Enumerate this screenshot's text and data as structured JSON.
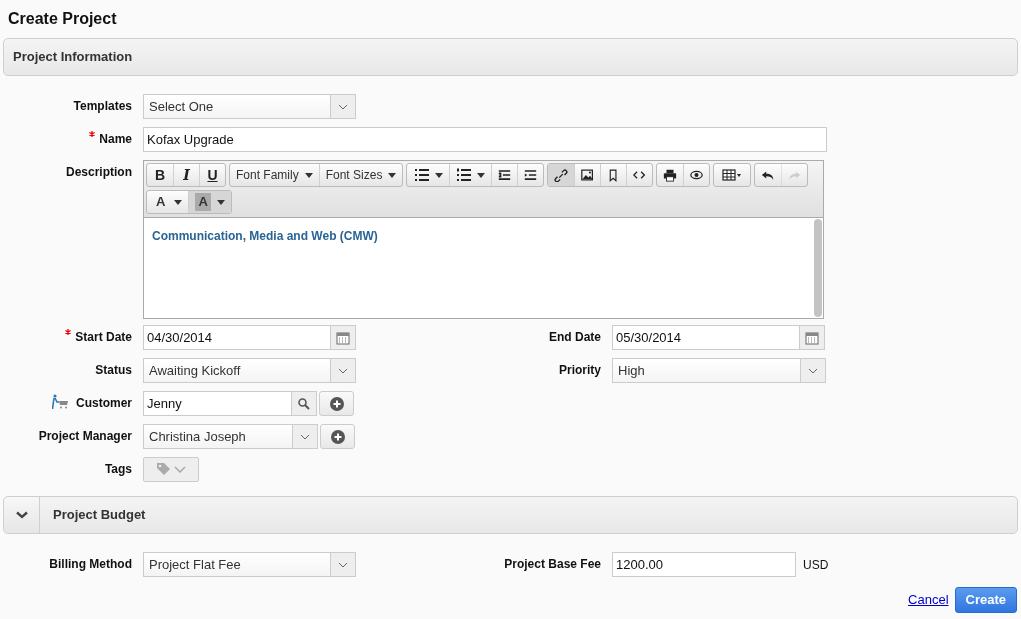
{
  "page_title": "Create Project",
  "info_section": {
    "title": "Project Information"
  },
  "templates": {
    "label": "Templates",
    "value": "Select One"
  },
  "name": {
    "label": "Name",
    "required": true,
    "value": "Kofax Upgrade"
  },
  "description": {
    "label": "Description",
    "toolbar": [
      [
        {
          "kind": "text",
          "label": "B",
          "selected": false,
          "disabled": false
        },
        {
          "kind": "text",
          "label": "I",
          "selected": false,
          "disabled": false
        },
        {
          "kind": "text",
          "label": "U",
          "selected": false,
          "disabled": false
        }
      ],
      [
        {
          "kind": "dropdown",
          "label": "Font Family",
          "selected": false,
          "disabled": false
        },
        {
          "kind": "dropdown",
          "label": "Font Sizes",
          "selected": false,
          "disabled": false
        }
      ],
      [
        {
          "kind": "bullets",
          "selected": false,
          "disabled": false
        },
        {
          "kind": "numbers",
          "selected": false,
          "disabled": false
        },
        {
          "kind": "outdent",
          "selected": false,
          "disabled": false
        },
        {
          "kind": "indent",
          "selected": false,
          "disabled": false
        }
      ],
      [
        {
          "kind": "link",
          "selected": true,
          "disabled": false
        },
        {
          "kind": "image",
          "selected": false,
          "disabled": false
        },
        {
          "kind": "bookmark",
          "selected": false,
          "disabled": false
        },
        {
          "kind": "code",
          "selected": false,
          "disabled": false
        }
      ],
      [
        {
          "kind": "print",
          "selected": false,
          "disabled": false
        },
        {
          "kind": "preview",
          "selected": false,
          "disabled": false
        }
      ],
      [
        {
          "kind": "table",
          "selected": false,
          "disabled": false
        }
      ],
      [
        {
          "kind": "undo",
          "selected": false,
          "disabled": false
        },
        {
          "kind": "redo",
          "selected": false,
          "disabled": true
        }
      ],
      [
        {
          "kind": "colordrop",
          "label": "A",
          "selected": false,
          "disabled": false
        },
        {
          "kind": "colordrop",
          "label": "A",
          "selected": true,
          "disabled": false
        }
      ]
    ],
    "content": "Communication, Media and Web (CMW)"
  },
  "start_date": {
    "label": "Start Date",
    "required": true,
    "value": "04/30/2014"
  },
  "end_date": {
    "label": "End Date",
    "required": false,
    "value": "05/30/2014"
  },
  "status": {
    "label": "Status",
    "value": "Awaiting Kickoff"
  },
  "priority": {
    "label": "Priority",
    "value": "High"
  },
  "customer": {
    "label": "Customer",
    "value": "Jenny"
  },
  "project_manager": {
    "label": "Project Manager",
    "value": "Christina Joseph"
  },
  "tags": {
    "label": "Tags"
  },
  "budget_section": {
    "title": "Project Budget",
    "expanded": true
  },
  "billing_method": {
    "label": "Billing Method",
    "value": "Project Flat Fee"
  },
  "base_fee": {
    "label": "Project Base Fee",
    "value": "1200.00",
    "currency": "USD"
  },
  "actions": {
    "cancel": "Cancel",
    "create": "Create"
  }
}
